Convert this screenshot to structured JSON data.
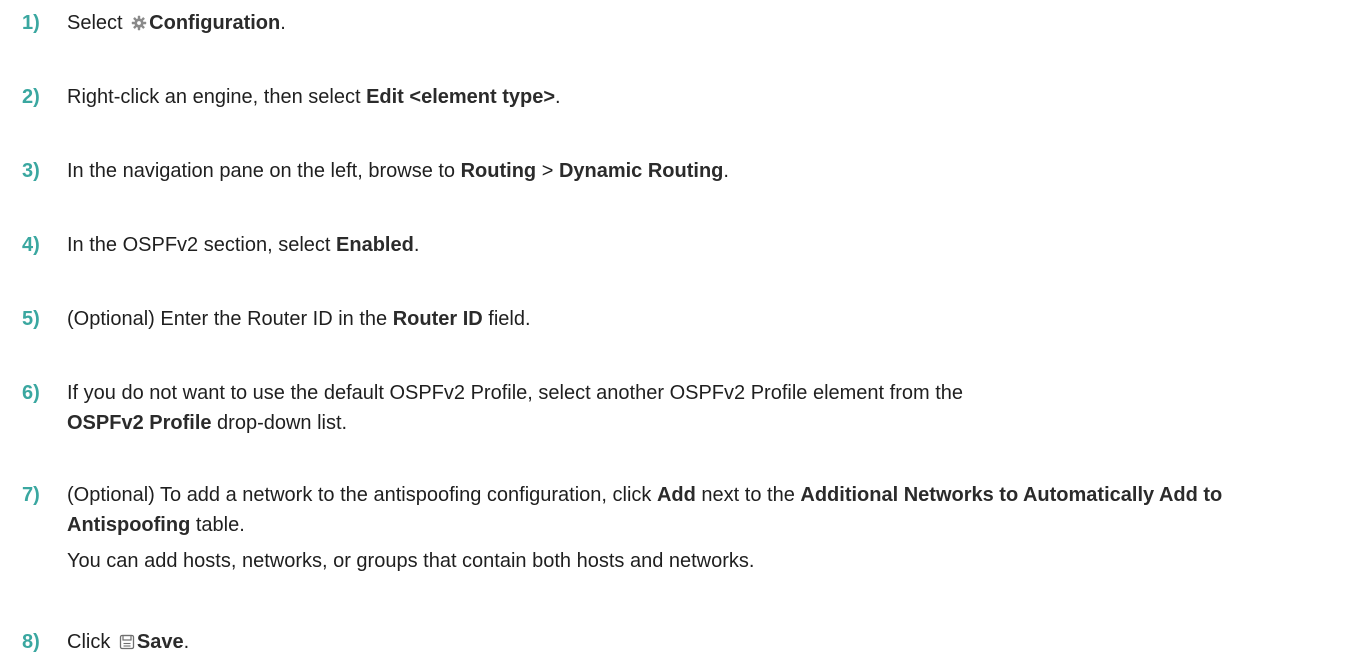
{
  "colors": {
    "step_number": "#3aa7a0",
    "text": "#1f1f1f",
    "icon": "#8a8a8a"
  },
  "steps": [
    {
      "number": "1)",
      "parts": [
        "Select ",
        "Configuration",
        "."
      ],
      "icon": "gear-icon"
    },
    {
      "number": "2)",
      "parts": [
        "Right-click an engine, then select ",
        "Edit <element type>",
        "."
      ]
    },
    {
      "number": "3)",
      "parts": [
        "In the navigation pane on the left, browse to ",
        "Routing",
        " > ",
        "Dynamic Routing",
        "."
      ]
    },
    {
      "number": "4)",
      "parts": [
        "In the OSPFv2 section, select ",
        "Enabled",
        "."
      ]
    },
    {
      "number": "5)",
      "parts": [
        "(Optional) Enter the Router ID in the ",
        "Router ID",
        " field."
      ]
    },
    {
      "number": "6)",
      "parts": [
        "If you do not want to use the default OSPFv2 Profile, select another OSPFv2 Profile element from the ",
        "OSPFv2 Profile",
        " drop-down list."
      ]
    },
    {
      "number": "7)",
      "parts": [
        "(Optional) To add a network to the antispoofing configuration, click ",
        "Add",
        " next to the ",
        "Additional Networks to Automatically Add to Antispoofing",
        " table."
      ],
      "note": "You can add hosts, networks, or groups that contain both hosts and networks."
    },
    {
      "number": "8)",
      "parts": [
        "Click ",
        "Save",
        "."
      ],
      "icon": "save-icon"
    }
  ]
}
